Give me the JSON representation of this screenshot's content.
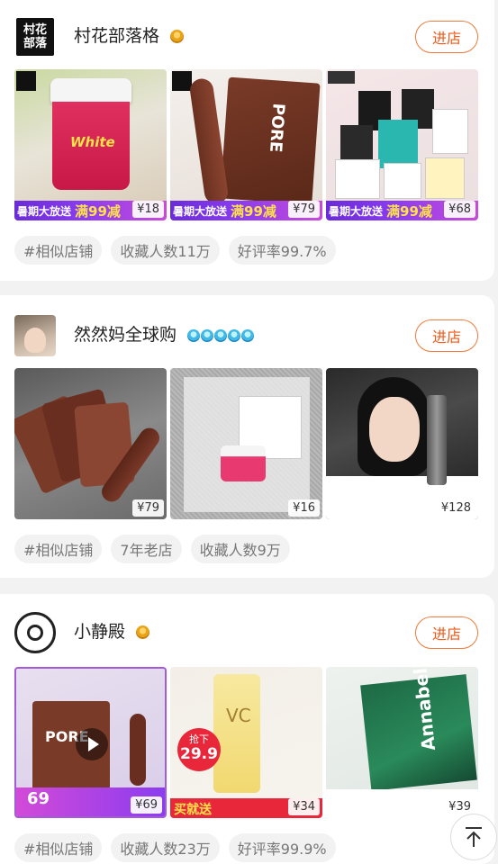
{
  "shops": [
    {
      "name": "村花部落格",
      "avatar_text": "村花部落",
      "level_icon": "crown-icon",
      "enter_label": "进店",
      "products": [
        {
          "price": "¥18",
          "promo": "暑期大放送",
          "promo_big": "满99减"
        },
        {
          "price": "¥79",
          "promo": "暑期大放送",
          "promo_big": "满99减"
        },
        {
          "price": "¥68",
          "promo": "暑期大放送",
          "promo_big": "满99减"
        }
      ],
      "tags": [
        "#相似店铺",
        "收藏人数11万",
        "好评率99.7%"
      ]
    },
    {
      "name": "然然妈全球购",
      "level_icon": "diamond-icon",
      "enter_label": "进店",
      "products": [
        {
          "price": "¥79"
        },
        {
          "price": "¥16"
        },
        {
          "price": "¥128"
        }
      ],
      "tags": [
        "#相似店铺",
        "7年老店",
        "收藏人数9万"
      ]
    },
    {
      "name": "小静殿",
      "level_icon": "crown-icon",
      "enter_label": "进店",
      "products": [
        {
          "price": "¥69",
          "badge": "69"
        },
        {
          "price": "¥34",
          "promo_text": "买就送",
          "sticker": "抢下",
          "sticker_price": "29.9"
        },
        {
          "price": "¥39",
          "box_text": "Annabella"
        }
      ],
      "tags": [
        "#相似店铺",
        "收藏人数23万",
        "好评率99.9%"
      ]
    }
  ],
  "colors": {
    "accent": "#f05a1a",
    "promo_purple": "#7a33e0",
    "promo_yellow": "#ffd000"
  }
}
